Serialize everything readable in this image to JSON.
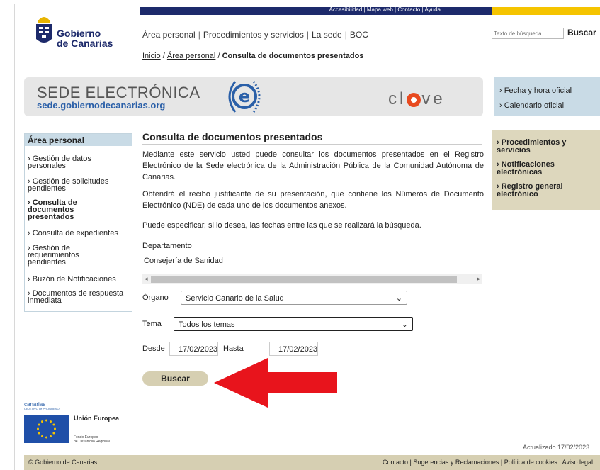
{
  "top_links": {
    "accesibilidad": "Accesibilidad",
    "mapa_web": "Mapa web",
    "contacto": "Contacto",
    "ayuda": "Ayuda"
  },
  "logo": {
    "line1": "Gobierno",
    "line2": "de Canarias"
  },
  "nav": {
    "area_personal": "Área personal",
    "procedimientos": "Procedimientos y servicios",
    "la_sede": "La sede",
    "boc": "BOC"
  },
  "search": {
    "placeholder": "Texto de búsqueda",
    "button": "Buscar"
  },
  "breadcrumb": {
    "inicio": "Inicio",
    "area_personal": "Área personal",
    "current": "Consulta de documentos presentados",
    "sep": "/"
  },
  "banner": {
    "title": "SEDE ELECTRÓNICA",
    "url": "sede.gobiernodecanarias.org",
    "clave_pre": "cl",
    "clave_post": "ve"
  },
  "right_top": [
    "Fecha y hora oficial",
    "Calendario oficial"
  ],
  "right_mid": [
    "Procedimientos y servicios",
    "Notificaciones electrónicas",
    "Registro general electrónico"
  ],
  "sidebar": {
    "title": "Área personal",
    "items": [
      "Gestión de datos personales",
      "Gestión de solicitudes pendientes",
      "Consulta de documentos presentados",
      "Consulta de expedientes",
      "Gestión de requerimientos pendientes",
      "Buzón de Notificaciones",
      "Documentos de respuesta inmediata"
    ]
  },
  "main": {
    "title": "Consulta de documentos presentados",
    "p1": "Mediante este servicio usted puede consultar los documentos presentados en el Registro Electrónico de la Sede electrónica de la Administración Pública de la Comunidad Autónoma de Canarias.",
    "p2": "Obtendrá el recibo justificante de su presentación, que contiene los Números de Documento Electrónico (NDE) de cada uno de los documentos anexos.",
    "p3": "Puede especificar, si lo desea, las fechas entre las que se realizará la búsqueda.",
    "departamento_label": "Departamento",
    "departamento_value": "Consejería de Sanidad",
    "organo_label": "Órgano",
    "organo_value": "Servicio Canario de la Salud",
    "tema_label": "Tema",
    "tema_value": "Todos los temas",
    "desde_label": "Desde",
    "desde_value": "17/02/2023",
    "hasta_label": "Hasta",
    "hasta_value": "17/02/2023",
    "buscar_button": "Buscar"
  },
  "eu": {
    "canarias": "canarias",
    "objetivo": "OBJETIVO de PROGRESO",
    "union": "Unión Europea",
    "fondo1": "Fondo Europeo",
    "fondo2": "de Desarrollo Regional"
  },
  "footer": {
    "updated": "Actualizado 17/02/2023",
    "copyright": "© Gobierno de Canarias",
    "contacto": "Contacto",
    "sugerencias": "Sugerencias y Reclamaciones",
    "cookies": "Política de cookies",
    "aviso": "Aviso legal"
  },
  "colors": {
    "navy": "#1d2a6b",
    "yellow": "#f5c400",
    "light_blue": "#c9dbe6",
    "beige": "#d6cfb2",
    "arrow_red": "#e8141c"
  }
}
